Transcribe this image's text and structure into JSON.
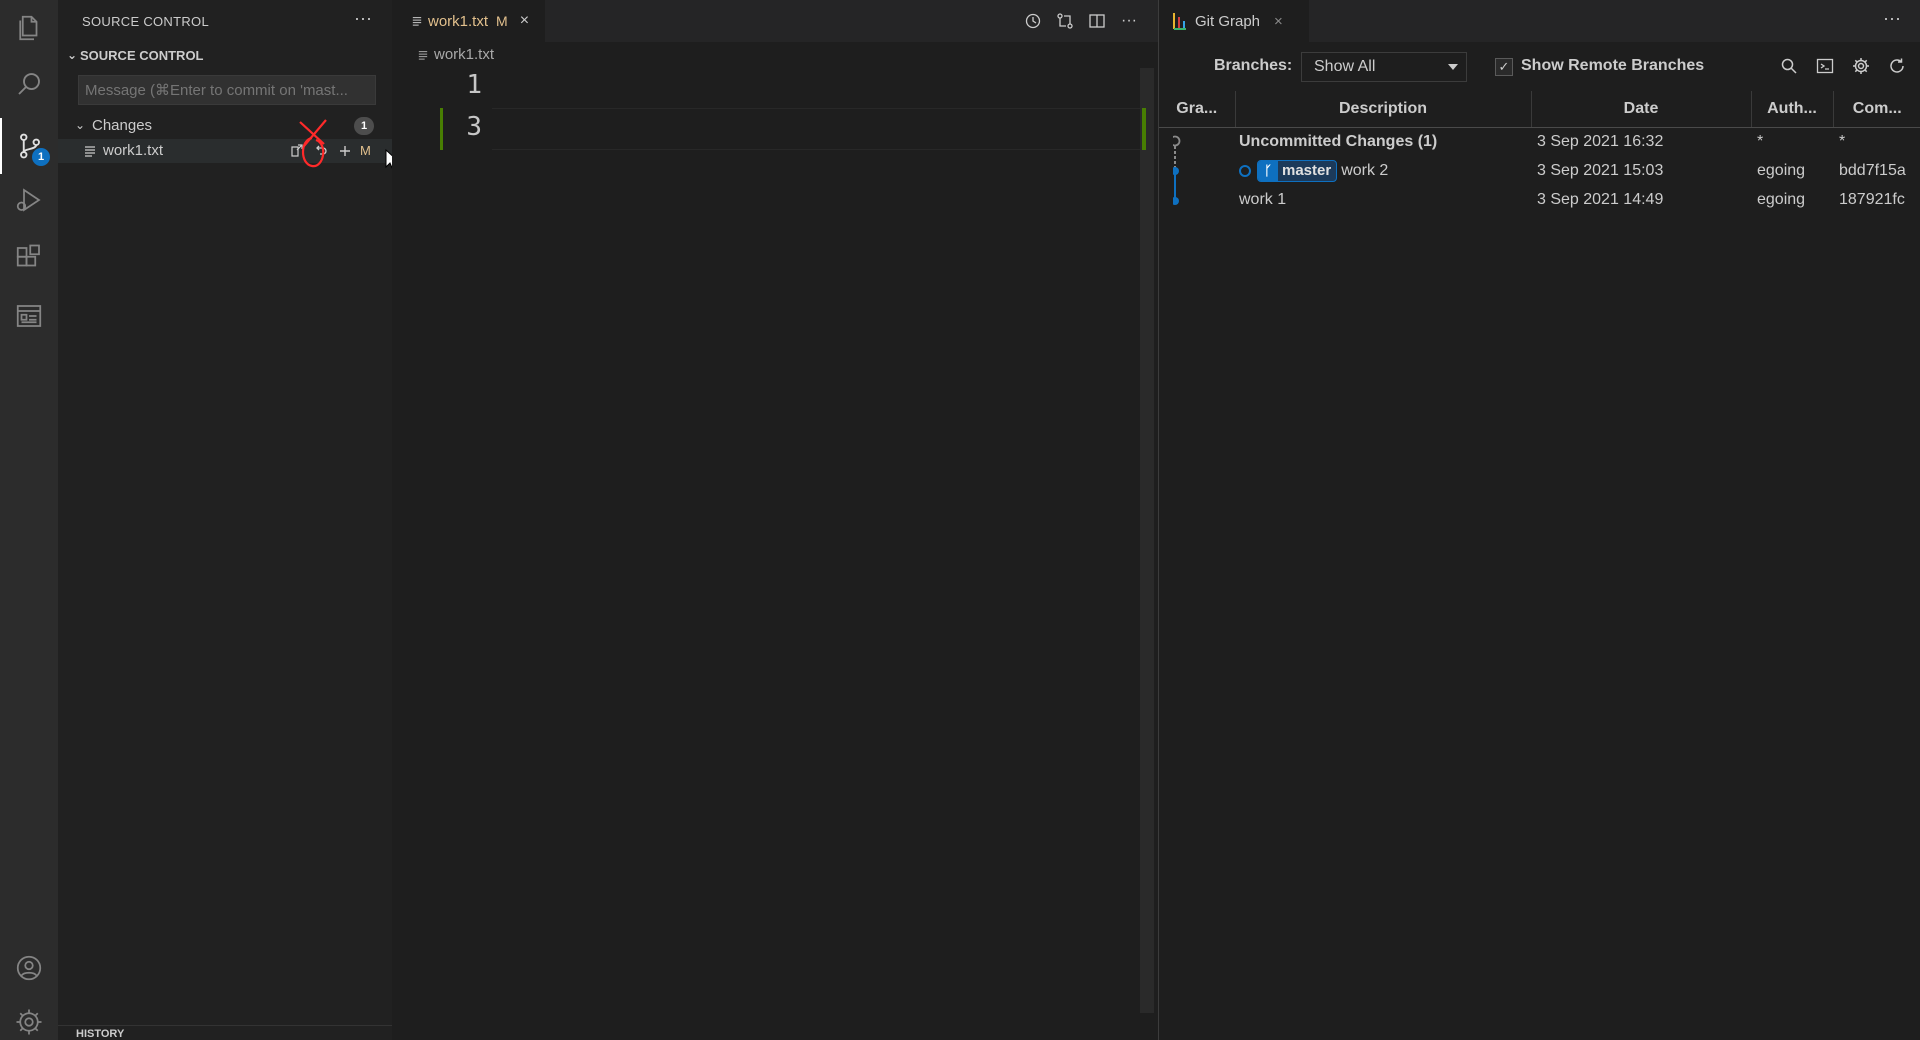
{
  "sidebar": {
    "title": "SOURCE CONTROL",
    "more": "···",
    "section_title": "SOURCE CONTROL",
    "message_placeholder": "Message (⌘Enter to commit on 'mast...",
    "changes_label": "Changes",
    "changes_count": "1",
    "file": {
      "name": "work1.txt",
      "status": "M"
    },
    "history_label": "HISTORY"
  },
  "activity": {
    "scm_badge": "1"
  },
  "editor": {
    "tab": {
      "name": "work1.txt",
      "status": "M",
      "close": "×"
    },
    "breadcrumb": "work1.txt",
    "lines": [
      "1",
      "3"
    ],
    "more": "···"
  },
  "git_graph": {
    "tab_name": "Git Graph",
    "tab_close": "×",
    "more": "···",
    "branches_label": "Branches:",
    "branches_value": "Show All",
    "remote_label": "Show Remote Branches",
    "remote_checked": "✓",
    "columns": [
      "Gra...",
      "Description",
      "Date",
      "Auth...",
      "Com..."
    ],
    "rows": [
      {
        "description": "Uncommitted Changes (1)",
        "date": "3 Sep 2021 16:32",
        "author": "*",
        "commit": "*"
      },
      {
        "branch": "master",
        "description": "work 2",
        "date": "3 Sep 2021 15:03",
        "author": "egoing",
        "commit": "bdd7f15a"
      },
      {
        "description": "work 1",
        "date": "3 Sep 2021 14:49",
        "author": "egoing",
        "commit": "187921fc"
      }
    ]
  },
  "colors": {
    "accent": "#0e70c0",
    "modified": "#e2c08d",
    "added_gutter": "#487e02",
    "annotation": "#ff2a2a"
  }
}
